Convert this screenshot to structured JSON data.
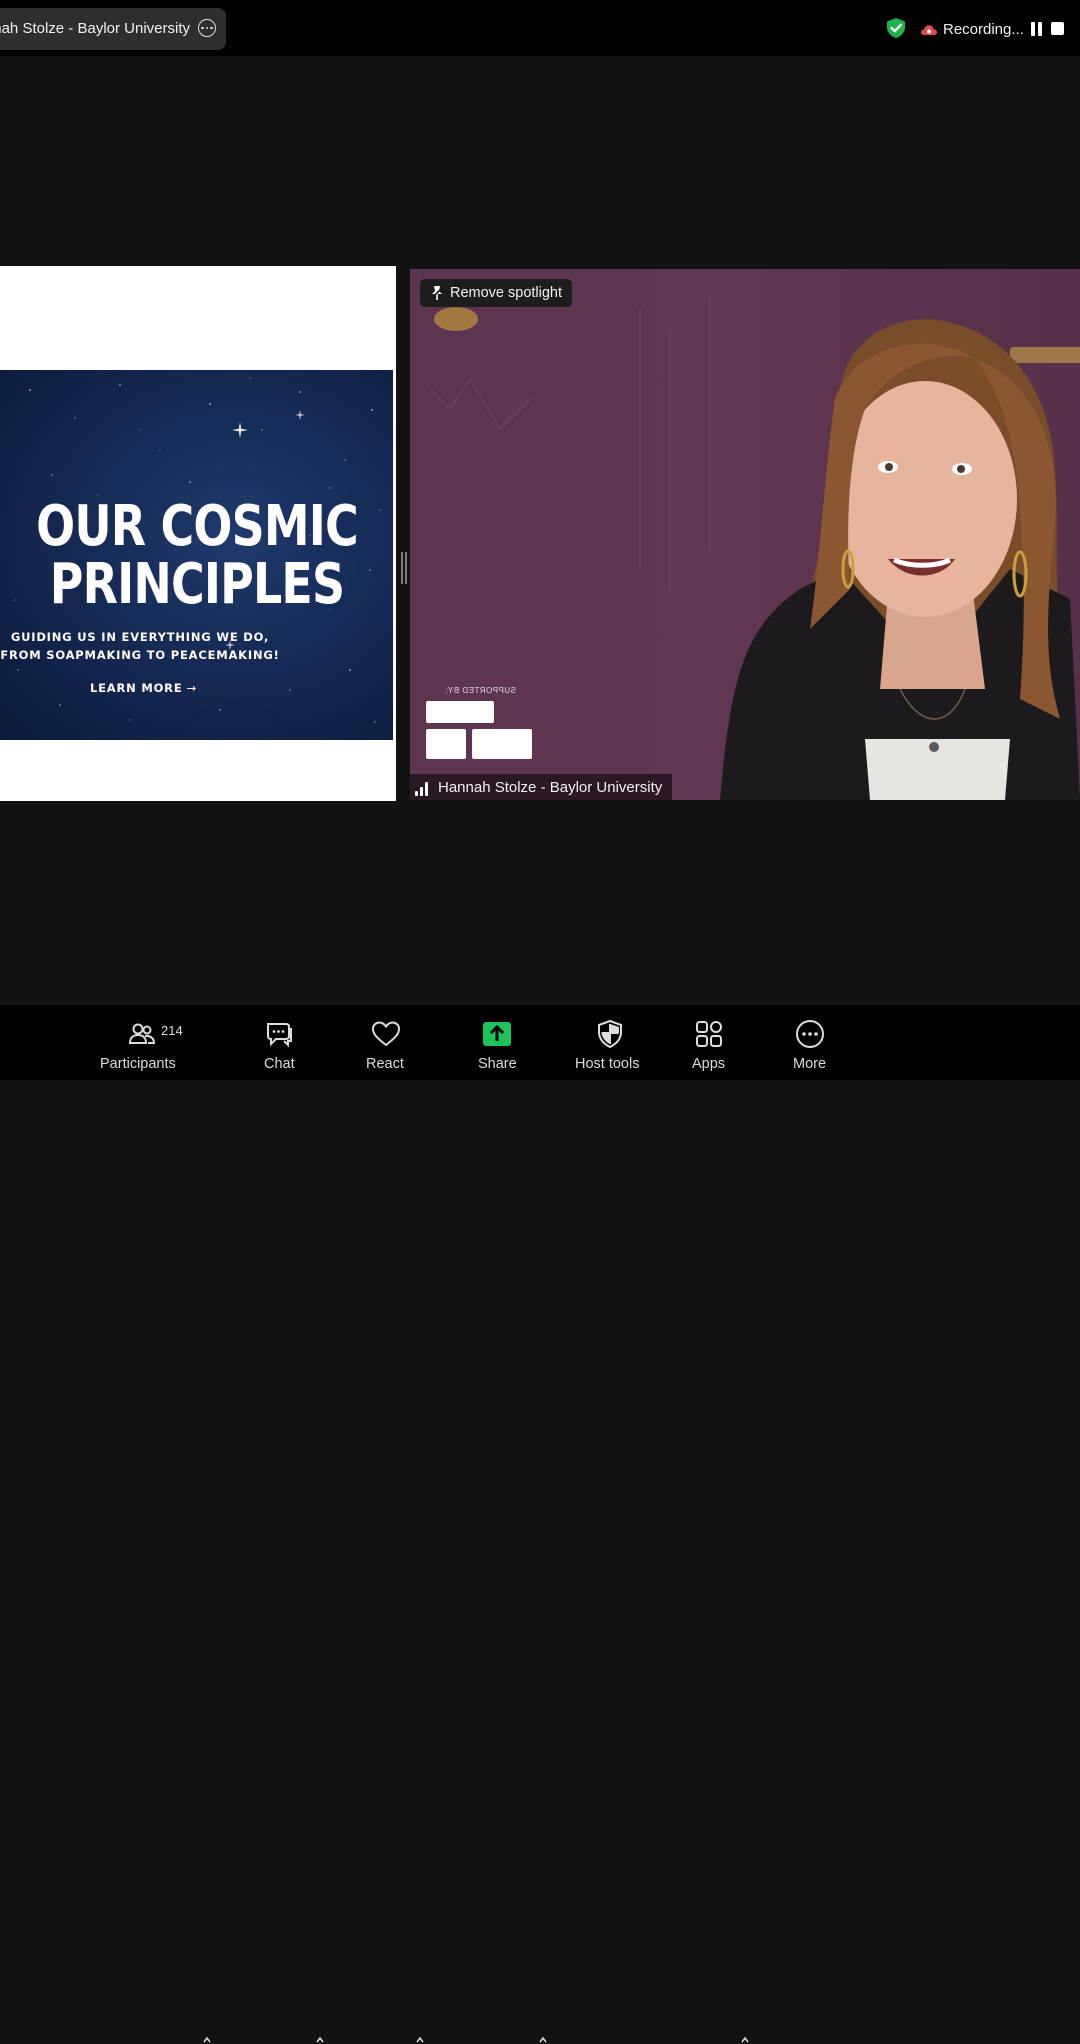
{
  "top_bar": {
    "meeting_name": "Hannah Stolze - Baylor University",
    "recording_label": "Recording...",
    "colors": {
      "shield": "#20b24a",
      "recording_cloud": "#e24b4b"
    }
  },
  "shared_screen": {
    "title_line1": "OUR COSMIC",
    "title_line2": "PRINCIPLES",
    "subtitle_line1": "GUIDING US IN EVERYTHING WE DO,",
    "subtitle_line2": "FROM SOAPMAKING TO PEACEMAKING!",
    "cta": "LEARN MORE",
    "cta_arrow": "→"
  },
  "video": {
    "spotlight_button": "Remove spotlight",
    "supported_by": "SUPPORTED BY:",
    "participant_name": "Hannah Stolze - Baylor University"
  },
  "toolbar": {
    "participants": {
      "label": "Participants",
      "count": "214"
    },
    "chat": {
      "label": "Chat"
    },
    "react": {
      "label": "React"
    },
    "share": {
      "label": "Share",
      "color": "#1cc35a"
    },
    "host_tools": {
      "label": "Host tools"
    },
    "apps": {
      "label": "Apps"
    },
    "more": {
      "label": "More"
    }
  }
}
